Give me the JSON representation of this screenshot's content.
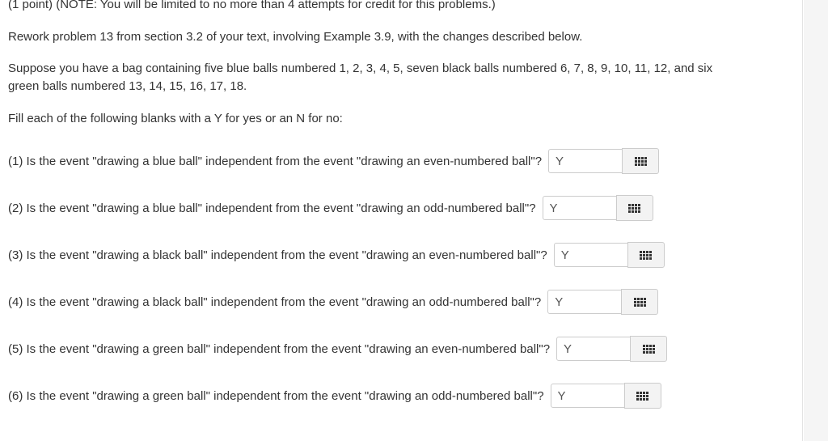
{
  "header": {
    "points_note": "(1 point) (NOTE: You will be limited to no more than 4 attempts for credit for this problems.)"
  },
  "intro": {
    "rework": "Rework problem 13 from section 3.2 of your text, involving Example 3.9, with the changes described below.",
    "suppose_line1": "Suppose you have a bag containing five blue balls numbered 1, 2, 3, 4, 5, seven black balls numbered 6, 7, 8, 9, 10, 11, 12, and six",
    "suppose_line2": "green balls numbered 13, 14, 15, 16, 17, 18.",
    "instructions": "Fill each of the following blanks with a Y for yes or an N for no:"
  },
  "questions": [
    {
      "text": "(1) Is the event \"drawing a blue ball\" independent from the event \"drawing an even-numbered ball\"?",
      "answer": "Y"
    },
    {
      "text": "(2) Is the event \"drawing a blue ball\" independent from the event \"drawing an odd-numbered ball\"?",
      "answer": "Y"
    },
    {
      "text": "(3) Is the event \"drawing a black ball\" independent from the event \"drawing an even-numbered ball\"?",
      "answer": "Y"
    },
    {
      "text": "(4) Is the event \"drawing a black ball\" independent from the event \"drawing an odd-numbered ball\"?",
      "answer": "Y"
    },
    {
      "text": "(5) Is the event \"drawing a green ball\" independent from the event \"drawing an even-numbered ball\"?",
      "answer": "Y"
    },
    {
      "text": "(6) Is the event \"drawing a green ball\" independent from the event \"drawing an odd-numbered ball\"?",
      "answer": "Y"
    }
  ],
  "palette_button": {
    "icon": "equation-palette-grid-icon"
  },
  "colors": {
    "text": "#333333",
    "input_border": "#cccccc",
    "button_bg": "#f3f3f3",
    "gutter_bg": "#f5f5f5"
  }
}
